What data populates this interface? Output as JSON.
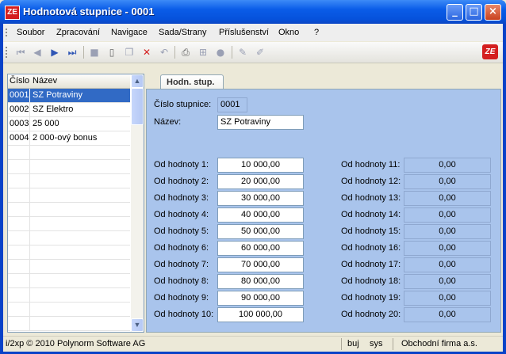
{
  "window": {
    "title": "Hodnotová stupnice - 0001",
    "app_icon": "ZE"
  },
  "menu": [
    "Soubor",
    "Zpracování",
    "Navigace",
    "Sada/Strany",
    "Příslušenství",
    "Okno",
    "?"
  ],
  "toolbar": {
    "icons": [
      "first-record-icon",
      "prev-record-icon",
      "next-record-icon",
      "last-record-icon",
      "save-icon",
      "new-icon",
      "copy-icon",
      "delete-icon",
      "undo-icon",
      "print-icon",
      "tree-icon",
      "disabled-icon",
      "edit-icon",
      "clear-icon"
    ],
    "logo": "ZE"
  },
  "grid": {
    "columns": [
      "Číslo",
      "Název"
    ],
    "rows": [
      {
        "code": "0001",
        "name": "SZ Potraviny",
        "selected": true
      },
      {
        "code": "0002",
        "name": "SZ Elektro"
      },
      {
        "code": "0003",
        "name": "25 000"
      },
      {
        "code": "0004",
        "name": "2 000-ový bonus"
      }
    ]
  },
  "form": {
    "tab": "Hodn. stup.",
    "cislo_label": "Číslo stupnice:",
    "cislo_value": "0001",
    "nazev_label": "Název:",
    "nazev_value": "SZ Potraviny",
    "left_values": [
      {
        "label": "Od hodnoty 1:",
        "value": "10 000,00"
      },
      {
        "label": "Od hodnoty 2:",
        "value": "20 000,00"
      },
      {
        "label": "Od hodnoty 3:",
        "value": "30 000,00"
      },
      {
        "label": "Od hodnoty 4:",
        "value": "40 000,00"
      },
      {
        "label": "Od hodnoty 5:",
        "value": "50 000,00"
      },
      {
        "label": "Od hodnoty 6:",
        "value": "60 000,00"
      },
      {
        "label": "Od hodnoty 7:",
        "value": "70 000,00"
      },
      {
        "label": "Od hodnoty 8:",
        "value": "80 000,00"
      },
      {
        "label": "Od hodnoty 9:",
        "value": "90 000,00"
      },
      {
        "label": "Od hodnoty 10:",
        "value": "100 000,00"
      }
    ],
    "right_values": [
      {
        "label": "Od hodnoty 11:",
        "value": "0,00"
      },
      {
        "label": "Od hodnoty 12:",
        "value": "0,00"
      },
      {
        "label": "Od hodnoty 13:",
        "value": "0,00"
      },
      {
        "label": "Od hodnoty 14:",
        "value": "0,00"
      },
      {
        "label": "Od hodnoty 15:",
        "value": "0,00"
      },
      {
        "label": "Od hodnoty 16:",
        "value": "0,00"
      },
      {
        "label": "Od hodnoty 17:",
        "value": "0,00"
      },
      {
        "label": "Od hodnoty 18:",
        "value": "0,00"
      },
      {
        "label": "Od hodnoty 19:",
        "value": "0,00"
      },
      {
        "label": "Od hodnoty 20:",
        "value": "0,00"
      }
    ]
  },
  "status": {
    "copyright": "i/2xp © 2010 Polynorm Software AG",
    "user": "buj",
    "db": "sys",
    "firm": "Obchodní firma a.s."
  },
  "colors": {
    "selection": "#316ac5",
    "panel": "#a9c4ec",
    "titlebar": "#0a5ce8",
    "delete": "#d41f1f"
  }
}
